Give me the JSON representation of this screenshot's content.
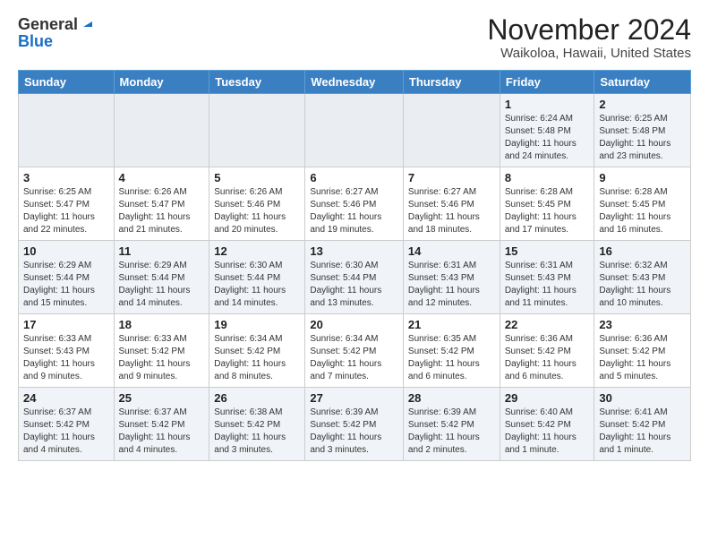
{
  "header": {
    "logo_general": "General",
    "logo_blue": "Blue",
    "month": "November 2024",
    "location": "Waikoloa, Hawaii, United States"
  },
  "weekdays": [
    "Sunday",
    "Monday",
    "Tuesday",
    "Wednesday",
    "Thursday",
    "Friday",
    "Saturday"
  ],
  "weeks": [
    [
      {
        "day": "",
        "info": ""
      },
      {
        "day": "",
        "info": ""
      },
      {
        "day": "",
        "info": ""
      },
      {
        "day": "",
        "info": ""
      },
      {
        "day": "",
        "info": ""
      },
      {
        "day": "1",
        "info": "Sunrise: 6:24 AM\nSunset: 5:48 PM\nDaylight: 11 hours and 24 minutes."
      },
      {
        "day": "2",
        "info": "Sunrise: 6:25 AM\nSunset: 5:48 PM\nDaylight: 11 hours and 23 minutes."
      }
    ],
    [
      {
        "day": "3",
        "info": "Sunrise: 6:25 AM\nSunset: 5:47 PM\nDaylight: 11 hours and 22 minutes."
      },
      {
        "day": "4",
        "info": "Sunrise: 6:26 AM\nSunset: 5:47 PM\nDaylight: 11 hours and 21 minutes."
      },
      {
        "day": "5",
        "info": "Sunrise: 6:26 AM\nSunset: 5:46 PM\nDaylight: 11 hours and 20 minutes."
      },
      {
        "day": "6",
        "info": "Sunrise: 6:27 AM\nSunset: 5:46 PM\nDaylight: 11 hours and 19 minutes."
      },
      {
        "day": "7",
        "info": "Sunrise: 6:27 AM\nSunset: 5:46 PM\nDaylight: 11 hours and 18 minutes."
      },
      {
        "day": "8",
        "info": "Sunrise: 6:28 AM\nSunset: 5:45 PM\nDaylight: 11 hours and 17 minutes."
      },
      {
        "day": "9",
        "info": "Sunrise: 6:28 AM\nSunset: 5:45 PM\nDaylight: 11 hours and 16 minutes."
      }
    ],
    [
      {
        "day": "10",
        "info": "Sunrise: 6:29 AM\nSunset: 5:44 PM\nDaylight: 11 hours and 15 minutes."
      },
      {
        "day": "11",
        "info": "Sunrise: 6:29 AM\nSunset: 5:44 PM\nDaylight: 11 hours and 14 minutes."
      },
      {
        "day": "12",
        "info": "Sunrise: 6:30 AM\nSunset: 5:44 PM\nDaylight: 11 hours and 14 minutes."
      },
      {
        "day": "13",
        "info": "Sunrise: 6:30 AM\nSunset: 5:44 PM\nDaylight: 11 hours and 13 minutes."
      },
      {
        "day": "14",
        "info": "Sunrise: 6:31 AM\nSunset: 5:43 PM\nDaylight: 11 hours and 12 minutes."
      },
      {
        "day": "15",
        "info": "Sunrise: 6:31 AM\nSunset: 5:43 PM\nDaylight: 11 hours and 11 minutes."
      },
      {
        "day": "16",
        "info": "Sunrise: 6:32 AM\nSunset: 5:43 PM\nDaylight: 11 hours and 10 minutes."
      }
    ],
    [
      {
        "day": "17",
        "info": "Sunrise: 6:33 AM\nSunset: 5:43 PM\nDaylight: 11 hours and 9 minutes."
      },
      {
        "day": "18",
        "info": "Sunrise: 6:33 AM\nSunset: 5:42 PM\nDaylight: 11 hours and 9 minutes."
      },
      {
        "day": "19",
        "info": "Sunrise: 6:34 AM\nSunset: 5:42 PM\nDaylight: 11 hours and 8 minutes."
      },
      {
        "day": "20",
        "info": "Sunrise: 6:34 AM\nSunset: 5:42 PM\nDaylight: 11 hours and 7 minutes."
      },
      {
        "day": "21",
        "info": "Sunrise: 6:35 AM\nSunset: 5:42 PM\nDaylight: 11 hours and 6 minutes."
      },
      {
        "day": "22",
        "info": "Sunrise: 6:36 AM\nSunset: 5:42 PM\nDaylight: 11 hours and 6 minutes."
      },
      {
        "day": "23",
        "info": "Sunrise: 6:36 AM\nSunset: 5:42 PM\nDaylight: 11 hours and 5 minutes."
      }
    ],
    [
      {
        "day": "24",
        "info": "Sunrise: 6:37 AM\nSunset: 5:42 PM\nDaylight: 11 hours and 4 minutes."
      },
      {
        "day": "25",
        "info": "Sunrise: 6:37 AM\nSunset: 5:42 PM\nDaylight: 11 hours and 4 minutes."
      },
      {
        "day": "26",
        "info": "Sunrise: 6:38 AM\nSunset: 5:42 PM\nDaylight: 11 hours and 3 minutes."
      },
      {
        "day": "27",
        "info": "Sunrise: 6:39 AM\nSunset: 5:42 PM\nDaylight: 11 hours and 3 minutes."
      },
      {
        "day": "28",
        "info": "Sunrise: 6:39 AM\nSunset: 5:42 PM\nDaylight: 11 hours and 2 minutes."
      },
      {
        "day": "29",
        "info": "Sunrise: 6:40 AM\nSunset: 5:42 PM\nDaylight: 11 hours and 1 minute."
      },
      {
        "day": "30",
        "info": "Sunrise: 6:41 AM\nSunset: 5:42 PM\nDaylight: 11 hours and 1 minute."
      }
    ]
  ]
}
